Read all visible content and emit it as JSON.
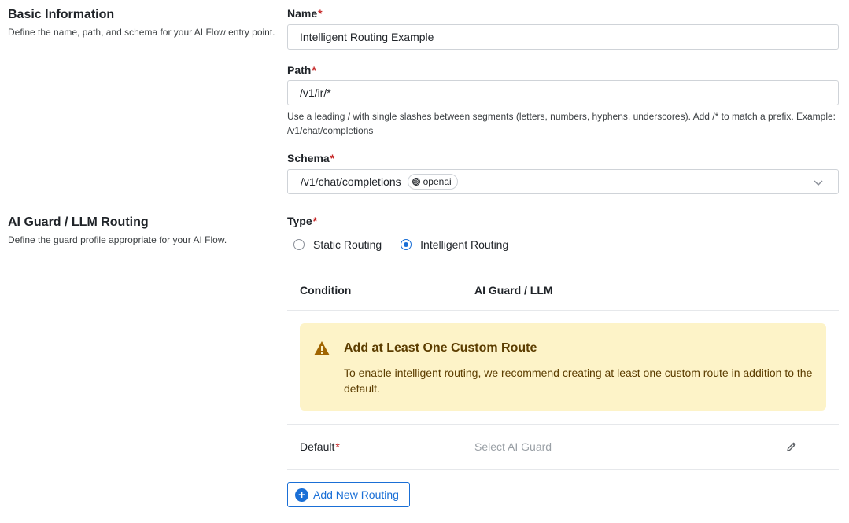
{
  "basic_info": {
    "title": "Basic Information",
    "description": "Define the name, path, and schema for your AI Flow entry point."
  },
  "name_field": {
    "label": "Name",
    "required_mark": "*",
    "value": "Intelligent Routing Example"
  },
  "path_field": {
    "label": "Path",
    "required_mark": "*",
    "value": "/v1/ir/*",
    "help": "Use a leading / with single slashes between segments (letters, numbers, hyphens, underscores). Add /* to match a prefix. Example: /v1/chat/completions"
  },
  "schema_field": {
    "label": "Schema",
    "required_mark": "*",
    "value": "/v1/chat/completions",
    "badge": "openai",
    "badge_icon": "openai-icon"
  },
  "guard_section": {
    "title": "AI Guard / LLM Routing",
    "description": "Define the guard profile appropriate for your AI Flow."
  },
  "type_field": {
    "label": "Type",
    "required_mark": "*",
    "options": [
      {
        "label": "Static Routing",
        "selected": false
      },
      {
        "label": "Intelligent Routing",
        "selected": true
      }
    ]
  },
  "routing_table": {
    "headers": [
      "Condition",
      "AI Guard / LLM"
    ],
    "alert": {
      "title": "Add at Least One Custom Route",
      "body": "To enable intelligent routing, we recommend creating at least one custom route in addition to the default.",
      "color": "#fdf3c8"
    },
    "default_row": {
      "label": "Default",
      "required_mark": "*",
      "placeholder": "Select AI Guard"
    }
  },
  "add_routing_button": {
    "label": "Add New Routing"
  },
  "colors": {
    "accent": "#1a6fd6",
    "required": "#c62828",
    "warning_icon": "#a06400"
  }
}
